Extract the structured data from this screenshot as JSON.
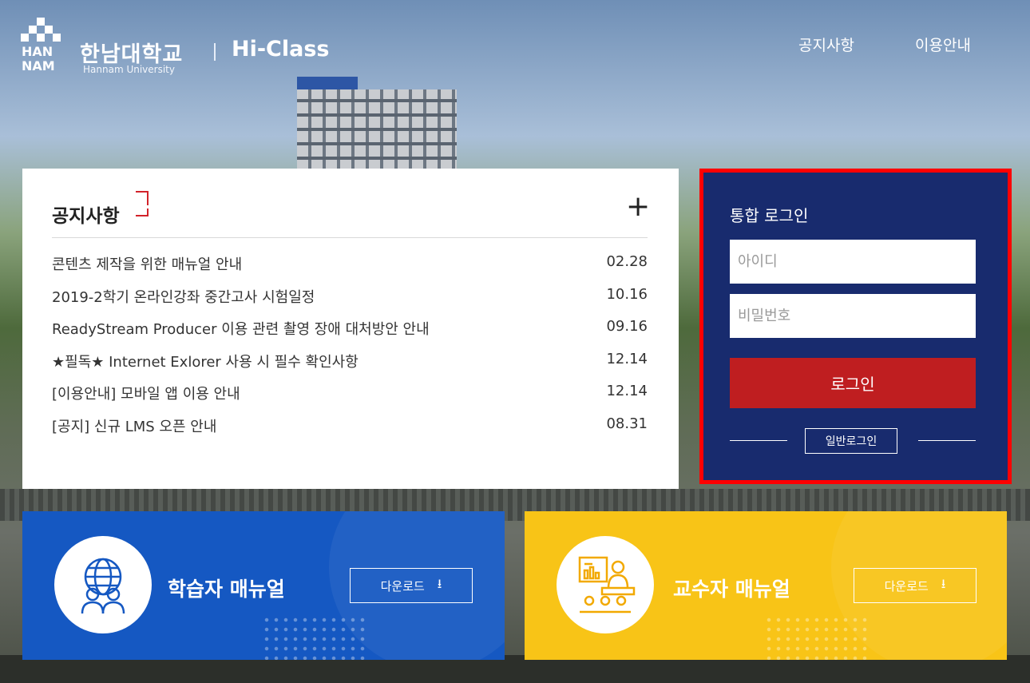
{
  "header": {
    "logo_korean": "한남대학교",
    "logo_product": "Hi-Class",
    "logo_english": "Hannam University",
    "logo_mark_text": "HAN NAM",
    "nav": [
      "공지사항",
      "이용안내"
    ]
  },
  "notice": {
    "title": "공지사항",
    "more_icon": "plus-icon",
    "items": [
      {
        "title": "콘텐츠 제작을 위한 매뉴얼 안내",
        "date": "02.28"
      },
      {
        "title": "2019-2학기 온라인강좌 중간고사 시험일정",
        "date": "10.16"
      },
      {
        "title": "ReadyStream Producer 이용 관련 촬영 장애 대처방안 안내",
        "date": "09.16"
      },
      {
        "title": "★필독★ Internet Exlorer 사용 시 필수 확인사항",
        "date": "12.14"
      },
      {
        "title": "[이용안내] 모바일 앱 이용 안내",
        "date": "12.14"
      },
      {
        "title": "[공지] 신규 LMS 오픈 안내",
        "date": "08.31"
      }
    ]
  },
  "login": {
    "title": "통합 로그인",
    "id_placeholder": "아이디",
    "pw_placeholder": "비밀번호",
    "submit": "로그인",
    "normal_login": "일반로그인"
  },
  "manuals": {
    "student": {
      "title": "학습자 매뉴얼",
      "download": "다운로드",
      "icon": "globe-students-icon",
      "color": "#1558c2"
    },
    "professor": {
      "title": "교수자 매뉴얼",
      "download": "다운로드",
      "icon": "lecture-presentation-icon",
      "color": "#f8c417"
    }
  },
  "colors": {
    "login_panel": "#182b6e",
    "login_button": "#bf1e20",
    "highlight_border": "#ff0000",
    "accent_red": "#d2232a"
  }
}
